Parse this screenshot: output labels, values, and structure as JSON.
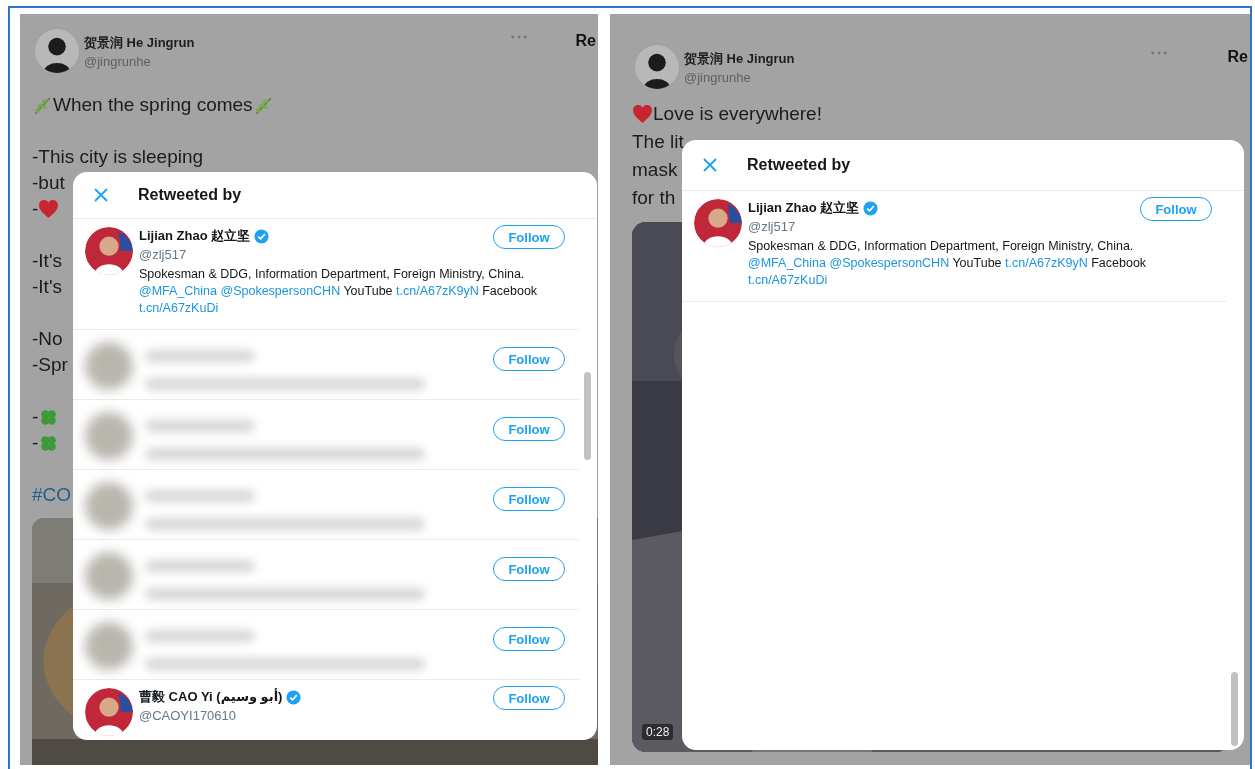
{
  "panels": [
    {
      "author": {
        "name": "贺景润 He Jingrun",
        "handle": "@jingrunhe"
      },
      "side_heading": "Re",
      "paragraphs": [
        [
          [
            {
              "kind": "leaf"
            },
            {
              "kind": "text",
              "text": "When the spring comes"
            },
            {
              "kind": "leaf"
            }
          ]
        ],
        [
          [
            {
              "kind": "text",
              "text": "-This city is sleeping"
            }
          ],
          [
            {
              "kind": "text",
              "text": "-but"
            }
          ],
          [
            {
              "kind": "text",
              "text": "-"
            },
            {
              "kind": "heart"
            }
          ]
        ],
        [
          [
            {
              "kind": "text",
              "text": "-It's"
            }
          ],
          [
            {
              "kind": "text",
              "text": "-It's"
            }
          ]
        ],
        [
          [
            {
              "kind": "text",
              "text": "-No"
            }
          ],
          [
            {
              "kind": "text",
              "text": "-Spr"
            }
          ]
        ],
        [
          [
            {
              "kind": "text",
              "text": "-"
            },
            {
              "kind": "clover"
            }
          ],
          [
            {
              "kind": "text",
              "text": "-"
            },
            {
              "kind": "clover"
            }
          ]
        ],
        [
          [
            {
              "kind": "hashtag",
              "text": "#CO"
            }
          ]
        ]
      ],
      "media": {
        "kind": "picture"
      },
      "modal": {
        "title": "Retweeted by",
        "users": [
          {
            "kind": "user",
            "name": "Lijian Zhao 赵立坚",
            "verified": true,
            "handle": "@zlj517",
            "bio": [
              {
                "kind": "text",
                "text": "Spokesman & DDG, Information Department, Foreign Ministry, China."
              },
              {
                "kind": "link",
                "text": "@MFA_China"
              },
              {
                "kind": "link",
                "text": "@SpokespersonCHN"
              },
              {
                "kind": "text",
                "text": "YouTube"
              },
              {
                "kind": "link",
                "text": "t.cn/A67zK9yN"
              },
              {
                "kind": "text",
                "text": "Facebook"
              },
              {
                "kind": "link",
                "text": "t.cn/A67zKuDi"
              }
            ],
            "follow": "Follow"
          },
          {
            "kind": "blurred",
            "follow": "Follow"
          },
          {
            "kind": "blurred",
            "follow": "Follow"
          },
          {
            "kind": "blurred",
            "follow": "Follow"
          },
          {
            "kind": "blurred",
            "follow": "Follow"
          },
          {
            "kind": "blurred",
            "follow": "Follow"
          },
          {
            "kind": "user",
            "name": "曹毅 CAO Yi (أبو وسيم)",
            "verified": true,
            "handle": "@CAOYI170610",
            "follow": "Follow"
          }
        ]
      }
    },
    {
      "author": {
        "name": "贺景润 He Jingrun",
        "handle": "@jingrunhe"
      },
      "side_heading": "Re",
      "paragraphs": [
        [
          [
            {
              "kind": "heart"
            },
            {
              "kind": "text",
              "text": "Love is everywhere!"
            }
          ],
          [
            {
              "kind": "text",
              "text": "The lit"
            }
          ],
          [
            {
              "kind": "text",
              "text": "mask"
            }
          ],
          [
            {
              "kind": "text",
              "text": "for th"
            }
          ]
        ]
      ],
      "media": {
        "kind": "picture",
        "duration": "0:28"
      },
      "modal": {
        "title": "Retweeted by",
        "users": [
          {
            "kind": "user",
            "name": "Lijian Zhao 赵立坚",
            "verified": true,
            "handle": "@zlj517",
            "bio": [
              {
                "kind": "text",
                "text": "Spokesman & DDG, Information Department, Foreign Ministry, China."
              },
              {
                "kind": "link",
                "text": "@MFA_China"
              },
              {
                "kind": "link",
                "text": "@SpokespersonCHN"
              },
              {
                "kind": "text",
                "text": "YouTube"
              },
              {
                "kind": "link",
                "text": "t.cn/A67zK9yN"
              },
              {
                "kind": "text",
                "text": "Facebook"
              },
              {
                "kind": "link",
                "text": "t.cn/A67zKuDi"
              }
            ],
            "follow": "Follow"
          }
        ]
      }
    }
  ]
}
